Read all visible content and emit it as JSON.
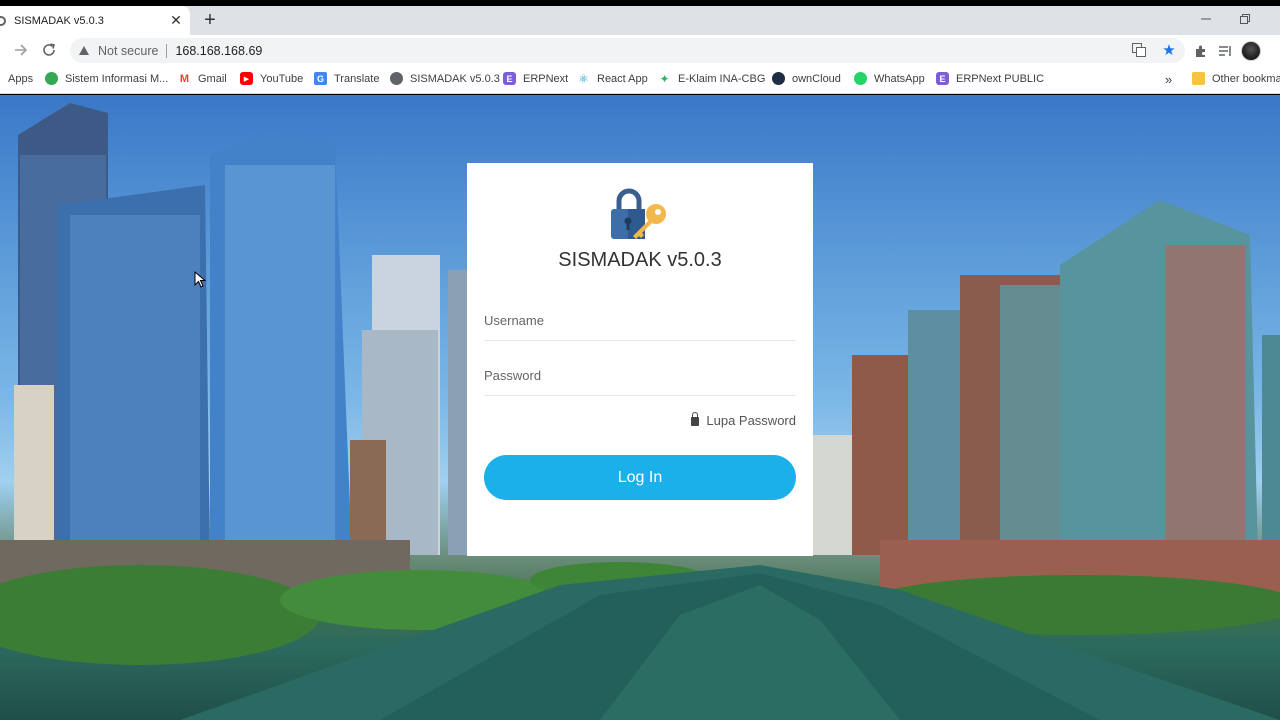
{
  "browser": {
    "tab_title": "SISMADAK v5.0.3",
    "close_glyph": "✕",
    "newtab_glyph": "+",
    "security_label": "Not secure",
    "url": "168.168.168.69",
    "bookmarks": [
      {
        "label": "Apps",
        "icon": "apps-grid-icon"
      },
      {
        "label": "Sistem Informasi M...",
        "icon": "site-icon",
        "color": "#34a853"
      },
      {
        "label": "Gmail",
        "icon": "gmail-icon",
        "color": "#ea4335"
      },
      {
        "label": "YouTube",
        "icon": "youtube-icon",
        "color": "#ff0000"
      },
      {
        "label": "Translate",
        "icon": "translate-icon",
        "color": "#4285f4"
      },
      {
        "label": "SISMADAK v5.0.3",
        "icon": "globe-icon",
        "color": "#5f6368"
      },
      {
        "label": "ERPNext",
        "icon": "erpnext-icon",
        "color": "#7c5fd6"
      },
      {
        "label": "React App",
        "icon": "react-icon",
        "color": "#18a0b8"
      },
      {
        "label": "E-Klaim INA-CBG",
        "icon": "eklaim-icon",
        "color": "#2fb56a"
      },
      {
        "label": "ownCloud",
        "icon": "owncloud-icon",
        "color": "#1d2d44"
      },
      {
        "label": "WhatsApp",
        "icon": "whatsapp-icon",
        "color": "#25d366"
      },
      {
        "label": "ERPNext PUBLIC",
        "icon": "erpnext-icon",
        "color": "#7c5fd6"
      },
      {
        "label": "Other bookma",
        "icon": "folder-icon",
        "color": "#f6c343"
      }
    ],
    "more_glyph": "»"
  },
  "login": {
    "title": "SISMADAK v5.0.3",
    "username_placeholder": "Username",
    "password_placeholder": "Password",
    "forgot_label": "Lupa Password",
    "submit_label": "Log In",
    "accent_color": "#1bb0ea"
  }
}
